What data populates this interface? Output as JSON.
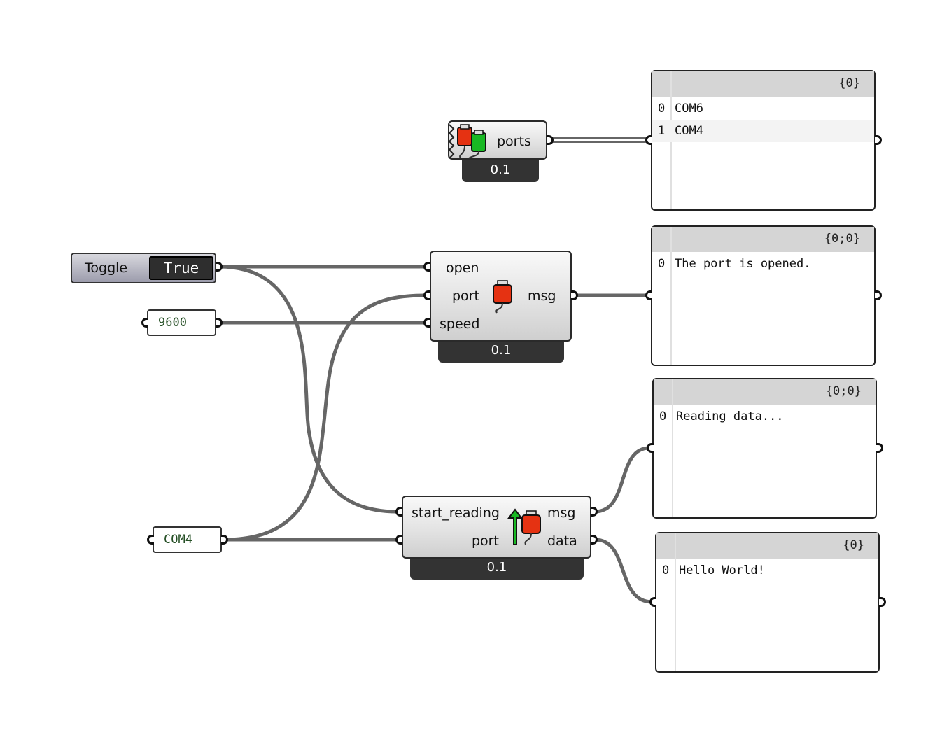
{
  "colors": {
    "wire": "#666666",
    "footer": "#333333",
    "canvas": "#ffffff",
    "field_text": "#254f25"
  },
  "ports_component": {
    "output": "ports",
    "version": "0.1",
    "icon": "usb-plug-red-green-icon"
  },
  "open_component": {
    "inputs": [
      "open",
      "port",
      "speed"
    ],
    "output": "msg",
    "version": "0.1",
    "icon": "usb-plug-red-icon"
  },
  "read_component": {
    "inputs": [
      "start_reading",
      "port"
    ],
    "outputs": [
      "msg",
      "data"
    ],
    "version": "0.1",
    "icon": "usb-plug-read-arrow-icon"
  },
  "toggle": {
    "label": "Toggle",
    "value": "True"
  },
  "speed_field": {
    "value": "9600"
  },
  "port_field": {
    "value": "COM4"
  },
  "panels": [
    {
      "path": "{0}",
      "rows": [
        {
          "i": "0",
          "v": "COM6"
        },
        {
          "i": "1",
          "v": "COM4"
        }
      ]
    },
    {
      "path": "{0;0}",
      "rows": [
        {
          "i": "0",
          "v": "The port is opened."
        }
      ]
    },
    {
      "path": "{0;0}",
      "rows": [
        {
          "i": "0",
          "v": "Reading data..."
        }
      ]
    },
    {
      "path": "{0}",
      "rows": [
        {
          "i": "0",
          "v": "Hello World!"
        }
      ]
    }
  ]
}
